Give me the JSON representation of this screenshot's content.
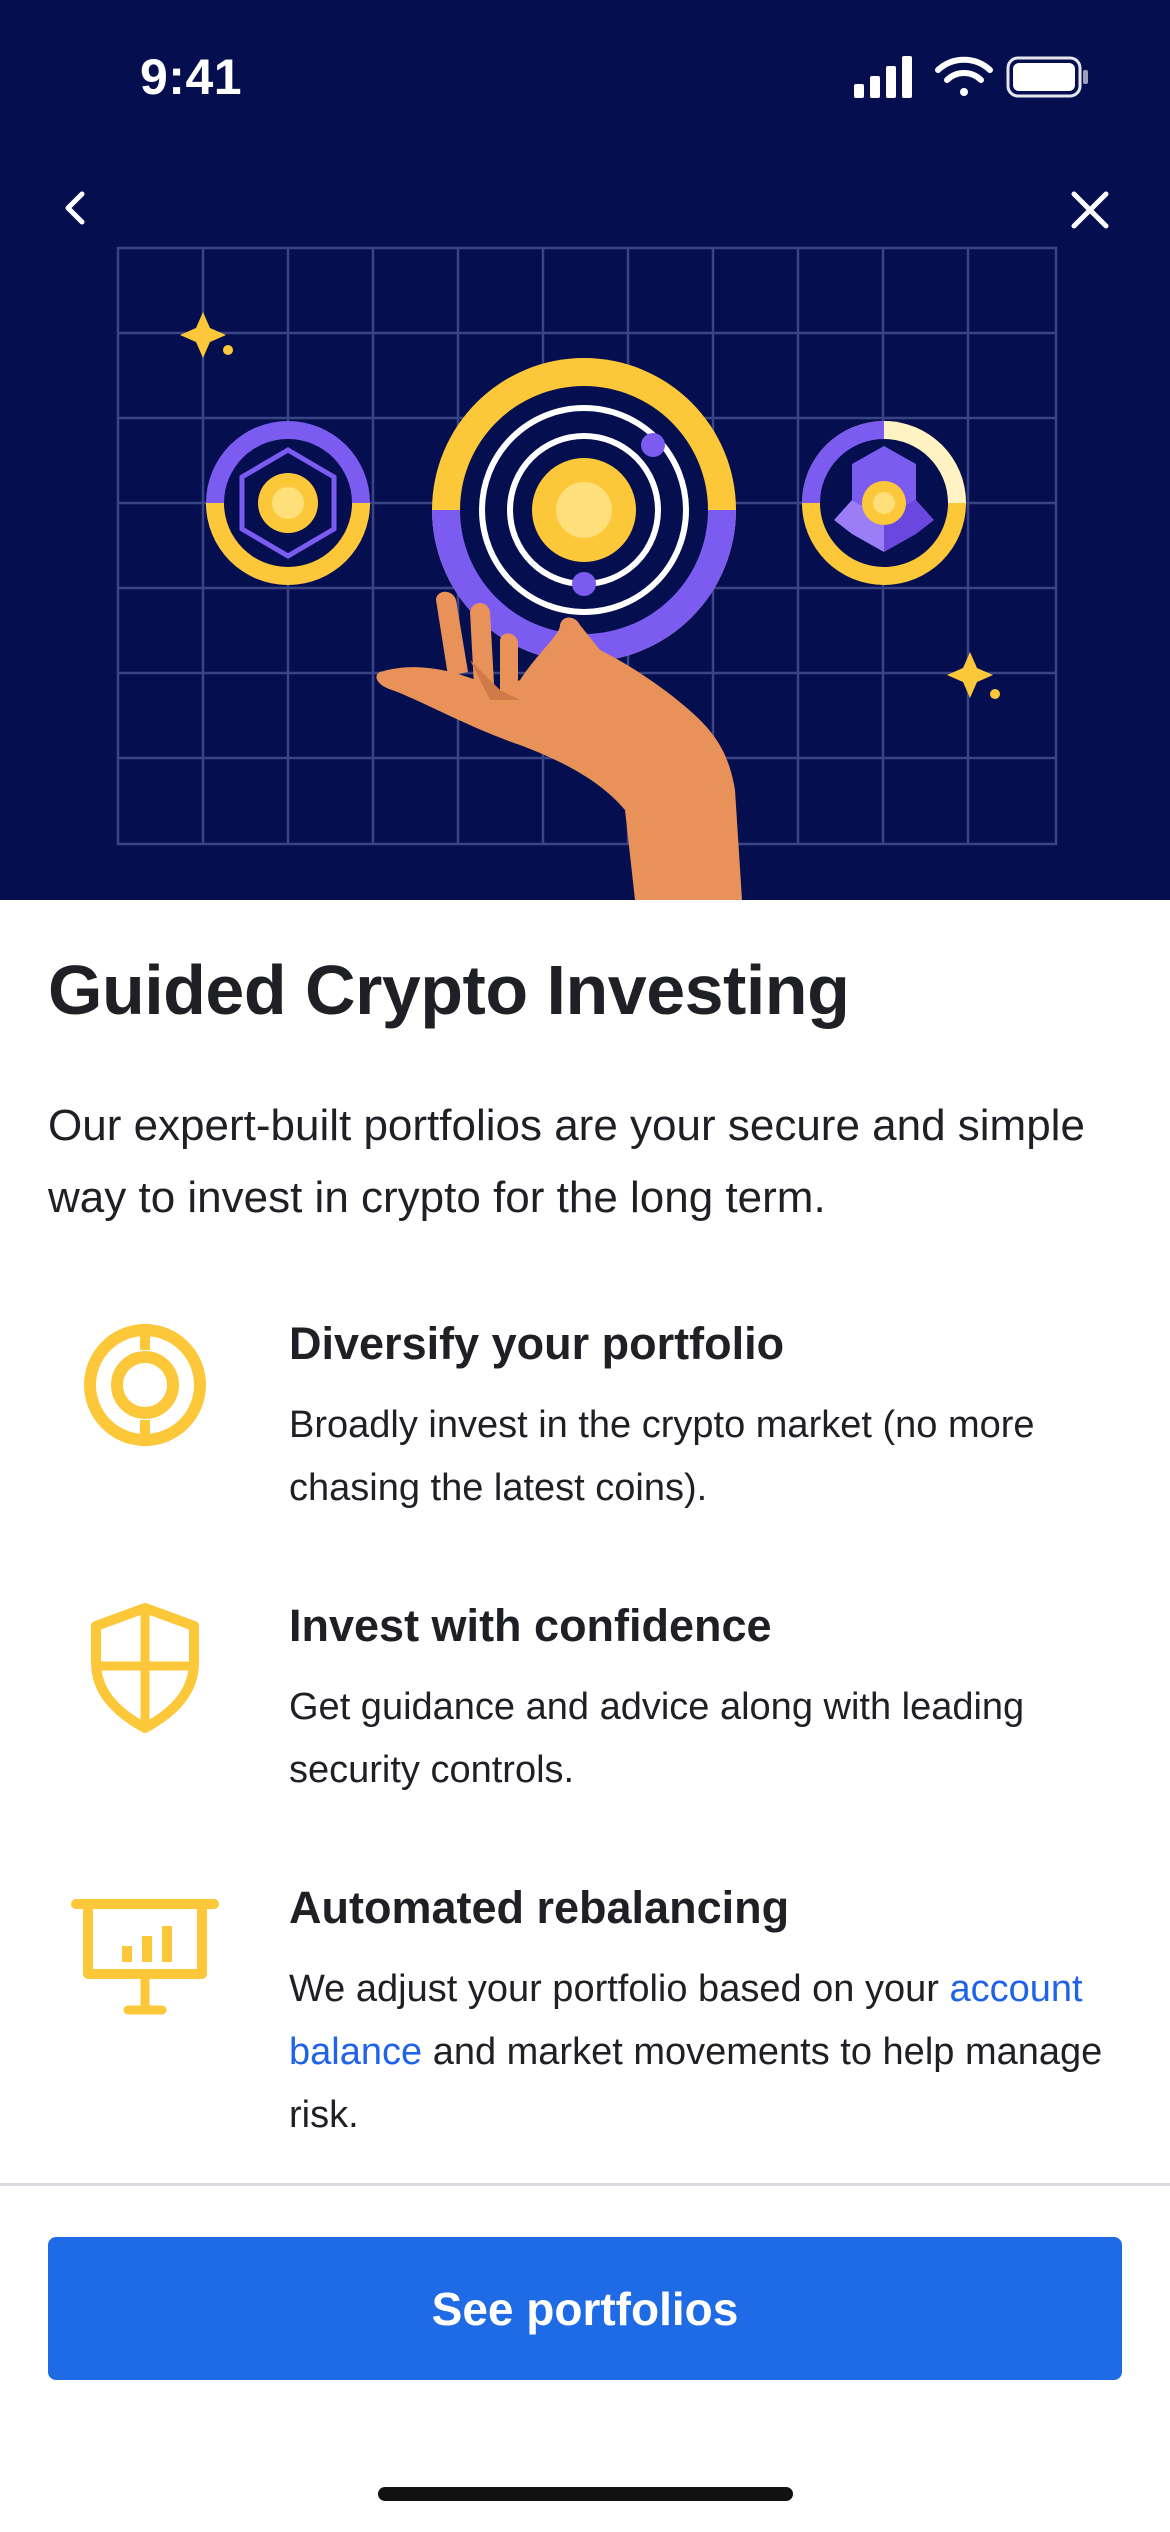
{
  "status_bar": {
    "time": "9:41",
    "icons": [
      "signal-icon",
      "wifi-icon",
      "battery-icon"
    ]
  },
  "nav": {
    "back_icon": "chevron-left-icon",
    "close_icon": "close-icon"
  },
  "colors": {
    "hero_background": "#050f4f",
    "accent_yellow": "#fcc83a",
    "accent_purple": "#7b5bf0",
    "primary_button": "#1f6be6",
    "link": "#1f64e8"
  },
  "page": {
    "title": "Guided Crypto Investing",
    "intro": "Our expert-built portfolios are your secure and simple way to invest in crypto for the long term."
  },
  "features": [
    {
      "icon": "target-ring-icon",
      "title": "Diversify your portfolio",
      "description": "Broadly invest in the crypto market (no more chasing the latest coins)."
    },
    {
      "icon": "shield-icon",
      "title": "Invest with confidence",
      "description": "Get guidance and advice along with leading security controls."
    },
    {
      "icon": "presentation-chart-icon",
      "title": "Automated rebalancing",
      "description_before": "We adjust your portfolio based on your",
      "description_link": "account balance",
      "description_after": "and market movements to help manage risk."
    }
  ],
  "cta": {
    "label": "See portfolios"
  }
}
